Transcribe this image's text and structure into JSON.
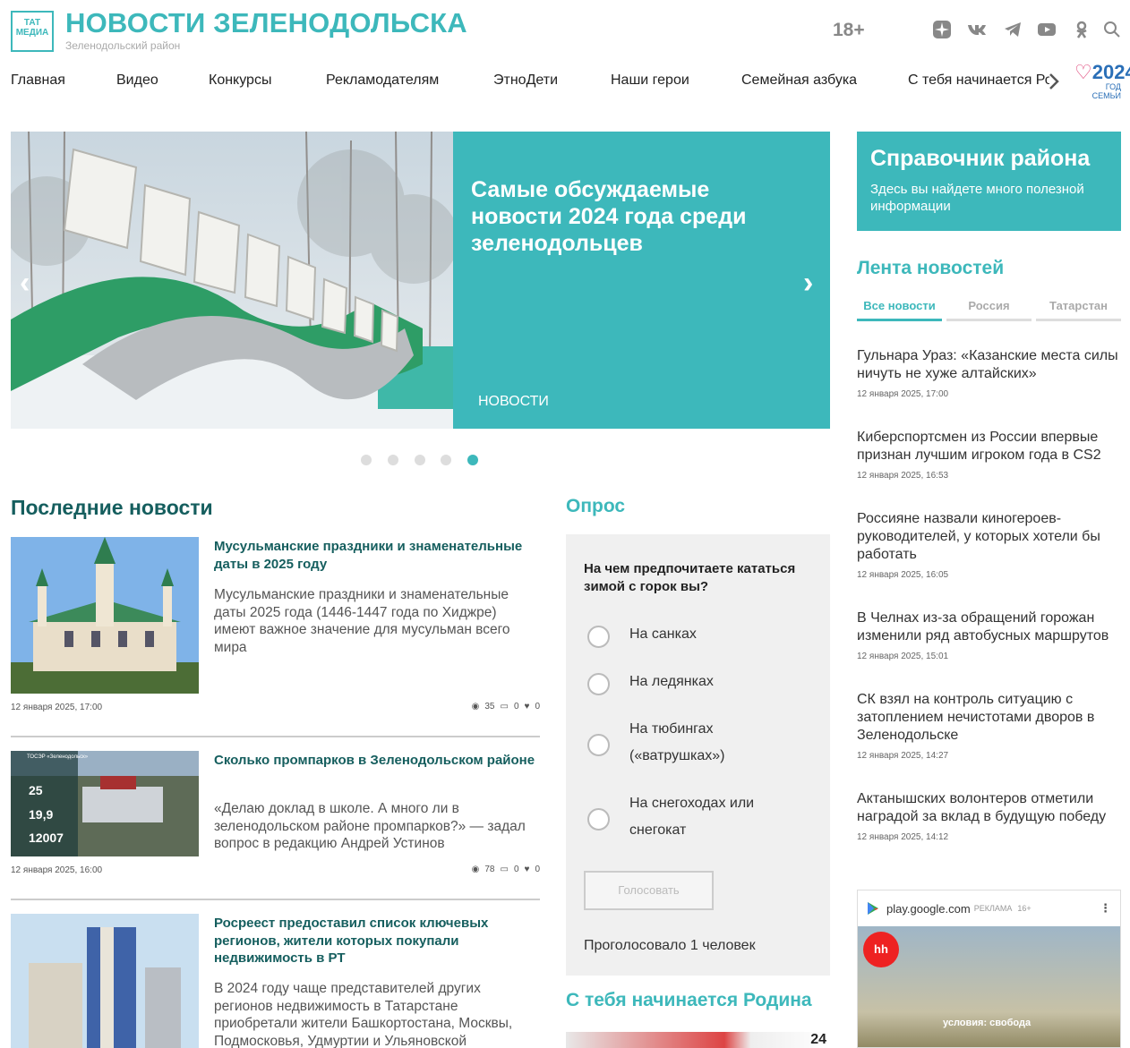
{
  "header": {
    "logo_top": "ТАТ",
    "logo_bottom": "МЕДИА",
    "title": "НОВОСТИ ЗЕЛЕНОДОЛЬСКА",
    "subtitle": "Зеленодольский район",
    "age_rating": "18+",
    "icons": [
      "zen-icon",
      "vk-icon",
      "telegram-icon",
      "youtube-icon",
      "odnoklassniki-icon",
      "search-icon"
    ]
  },
  "nav": {
    "items": [
      "Главная",
      "Видео",
      "Конкурсы",
      "Рекламодателям",
      "ЭтноДети",
      "Наши герои",
      "Семейная азбука",
      "С тебя начинается Родина"
    ],
    "year_logo": "2024",
    "year_logo_sub": "ГОД СЕМЬИ"
  },
  "slider": {
    "title": "Самые обсуждаемые новости 2024 года среди зеленодольцев",
    "category": "НОВОСТИ",
    "prev": "‹",
    "next": "›",
    "dots": 5,
    "active_dot": 5
  },
  "sidebar": {
    "ref_title": "Справочник района",
    "ref_desc": "Здесь вы найдете много полезной информации",
    "feed_title": "Лента новостей",
    "tabs": [
      "Все новости",
      "Россия",
      "Татарстан"
    ],
    "feed": [
      {
        "title": "Гульнара Ураз: «Казанские места силы ничуть не хуже алтайских»",
        "date": "12 января 2025, 17:00"
      },
      {
        "title": "Киберспортсмен из России впервые признан лучшим игроком года в CS2",
        "date": "12 января 2025, 16:53"
      },
      {
        "title": "Россияне назвали киногероев-руководителей, у которых хотели бы работать",
        "date": "12 января 2025, 16:05"
      },
      {
        "title": "В Челнах из-за обращений горожан изменили ряд автобусных маршрутов",
        "date": "12 января 2025, 15:01"
      },
      {
        "title": "СК взял на контроль ситуацию с затоплением нечистотами дворов в Зеленодольске",
        "date": "12 января 2025, 14:27"
      },
      {
        "title": "Актанышских волонтеров отметили наградой за вклад в будущую победу",
        "date": "12 января 2025, 14:12"
      }
    ],
    "ad": {
      "domain": "play.google.com",
      "label": "РЕКЛАМА",
      "age": "16+",
      "caption": "условия: свобода"
    }
  },
  "news": {
    "section_title": "Последние новости",
    "items": [
      {
        "title": "Мусульманские праздники и знаменательные даты в 2025 году",
        "lead": "Мусульманские праздники и знаменательные даты 2025 года (1446-1447 года по Хиджре) имеют важное значение для мусульман всего мира",
        "date": "12 января 2025, 17:00",
        "views": "35",
        "comments": "0",
        "likes": "0"
      },
      {
        "title": "Сколько промпарков в Зеленодольском районе",
        "lead": "«Делаю доклад в школе. А много ли в зеленодольском районе промпарков?» — задал вопрос в редакцию Андрей Устинов",
        "date": "12 января 2025, 16:00",
        "views": "78",
        "comments": "0",
        "likes": "0",
        "img_caption_a": "ТОСЭР «Зеленодольск»",
        "img_num1": "25",
        "img_num2": "19,9",
        "img_num3": "12007"
      },
      {
        "title": "Росреест предоставил список ключевых регионов, жители которых покупали недвижимость в РТ",
        "lead": "В 2024 году чаще представителей других регионов недвижимость в Татарстане приобретали жители Башкортостана, Москвы, Подмосковья, Удмуртии и Ульяновской"
      }
    ]
  },
  "poll": {
    "title": "Опрос",
    "question": "На чем предпочитаете кататься зимой с горок вы?",
    "options": [
      "На санках",
      "На ледянках",
      "На тюбингах («ватрушках»)",
      "На снегоходах или снегокат"
    ],
    "vote_label": "Голосовать",
    "voted_text": "Проголосовало 1 человек"
  },
  "rodina": {
    "title": "С тебя начинается Родина",
    "badge": "24"
  },
  "colors": {
    "accent": "#3db8bb",
    "dark_teal": "#155e5e"
  }
}
